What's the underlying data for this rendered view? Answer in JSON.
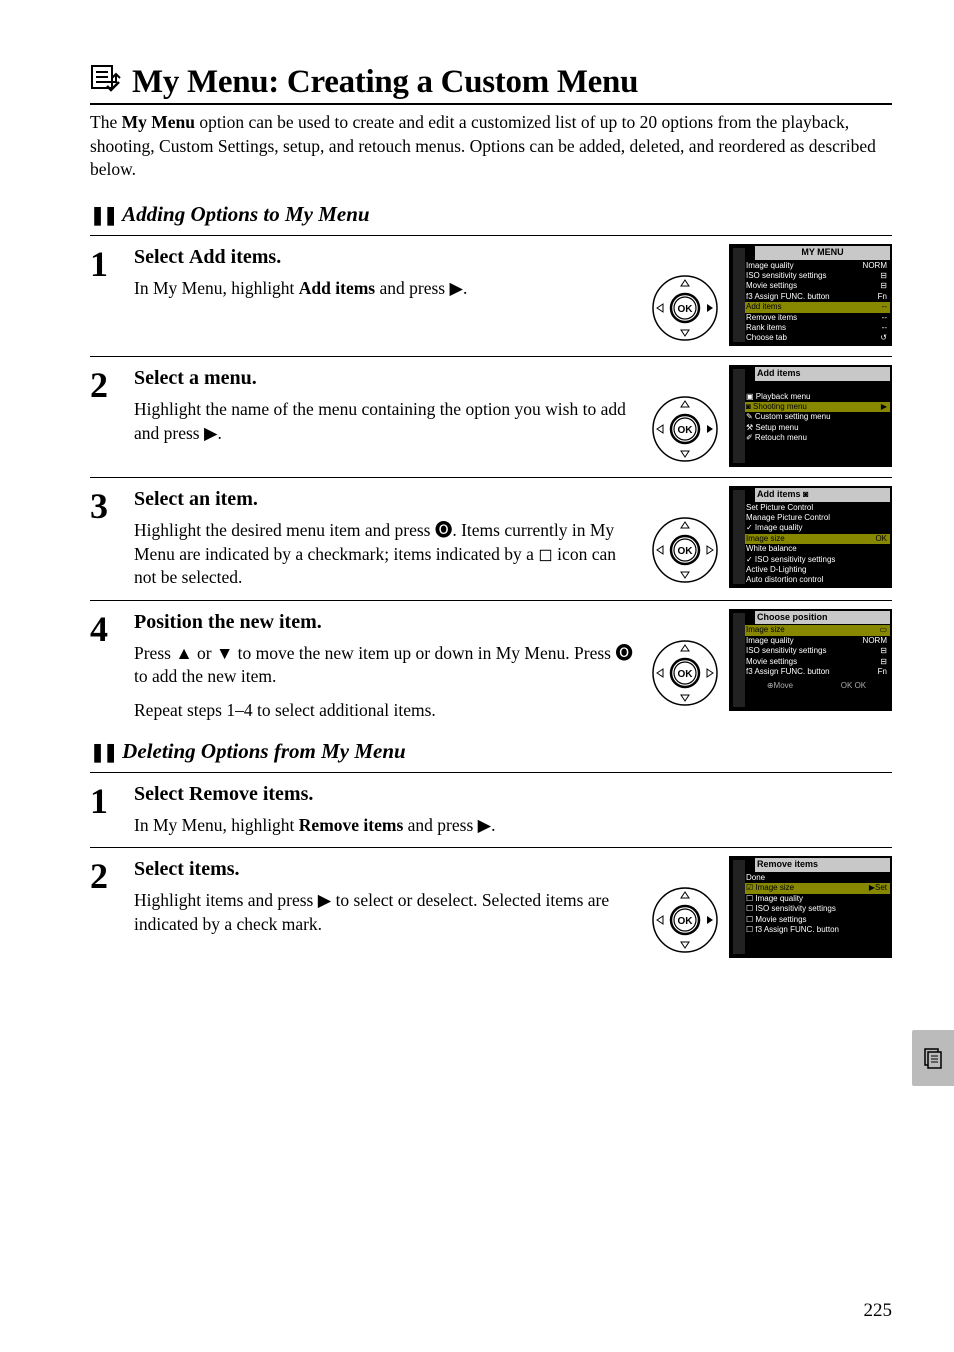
{
  "pageNumber": "225",
  "title": "My Menu: Creating a Custom Menu",
  "intro_before": "The ",
  "intro_bold": "My Menu",
  "intro_after": " option can be used to create and edit a customized list of up to 20 options from the playback, shooting, Custom Settings, setup, and retouch menus. Options can be added, deleted, and reordered as described below.",
  "sections": {
    "add": {
      "heading": "Adding Options to My Menu",
      "steps": [
        {
          "num": "1",
          "title_pre": "Select ",
          "title_bold": "Add items",
          "title_post": ".",
          "body_pre": "In My Menu, highlight ",
          "body_bold": "Add items",
          "body_post": " and press ▶."
        },
        {
          "num": "2",
          "title_pre": "Select a menu.",
          "title_bold": "",
          "title_post": "",
          "body_pre": "Highlight the name of the menu containing the option you wish to add and press ▶.",
          "body_bold": "",
          "body_post": ""
        },
        {
          "num": "3",
          "title_pre": "Select an item.",
          "title_bold": "",
          "title_post": "",
          "body_pre": "Highlight the desired menu item and press 🅞. Items currently in My Menu are indicated by a checkmark; items indicated by a ◻ icon can not be selected.",
          "body_bold": "",
          "body_post": ""
        },
        {
          "num": "4",
          "title_pre": "Position the new item.",
          "title_bold": "",
          "title_post": "",
          "body_pre": "Press ▲ or ▼ to move the new item up or down in My Menu.  Press 🅞 to add the new item.",
          "body_bold": "",
          "body_post": "",
          "body2": "Repeat steps 1–4 to select additional items."
        }
      ]
    },
    "del": {
      "heading": "Deleting Options from My Menu",
      "steps": [
        {
          "num": "1",
          "title_pre": "Select ",
          "title_bold": "Remove items",
          "title_post": ".",
          "body_pre": "In My Menu, highlight ",
          "body_bold": "Remove items",
          "body_post": " and press ▶."
        },
        {
          "num": "2",
          "title_pre": "Select items.",
          "title_bold": "",
          "title_post": "",
          "body_pre": "Highlight items and press ▶ to select or deselect.  Selected items are indicated by a check mark.",
          "body_bold": "",
          "body_post": ""
        }
      ]
    }
  },
  "lcd": {
    "s1": {
      "header": "MY MENU",
      "rows": [
        {
          "l": "Image quality",
          "r": "NORM"
        },
        {
          "l": "ISO sensitivity settings",
          "r": "⊟"
        },
        {
          "l": "Movie settings",
          "r": "⊟"
        },
        {
          "l": "f3 Assign FUNC. button",
          "r": "Fn"
        },
        {
          "l": "Add items",
          "r": "--",
          "sel": true
        },
        {
          "l": "Remove items",
          "r": "--"
        },
        {
          "l": "Rank items",
          "r": "--"
        },
        {
          "l": "Choose tab",
          "r": "↺"
        }
      ]
    },
    "s2": {
      "header": "Add items",
      "rows": [
        {
          "l": "▣  Playback menu",
          "r": ""
        },
        {
          "l": "◙  Shooting menu",
          "r": "▶",
          "sel": true
        },
        {
          "l": "✎  Custom setting menu",
          "r": ""
        },
        {
          "l": "⚒  Setup menu",
          "r": ""
        },
        {
          "l": "✐  Retouch menu",
          "r": ""
        }
      ]
    },
    "s3": {
      "header": "Add items  ◙",
      "rows": [
        {
          "l": "   Set Picture Control",
          "r": ""
        },
        {
          "l": "   Manage Picture Control",
          "r": ""
        },
        {
          "l": "✓  Image quality",
          "r": ""
        },
        {
          "l": "   Image size",
          "r": "OK",
          "sel": true
        },
        {
          "l": "   White balance",
          "r": ""
        },
        {
          "l": "✓  ISO sensitivity settings",
          "r": ""
        },
        {
          "l": "   Active D-Lighting",
          "r": ""
        },
        {
          "l": "   Auto distortion control",
          "r": ""
        }
      ]
    },
    "s4": {
      "header": "Choose position",
      "rows": [
        {
          "l": "Image size",
          "r": "▭",
          "sel": true
        },
        {
          "l": "Image quality",
          "r": "NORM"
        },
        {
          "l": "ISO sensitivity settings",
          "r": "⊟"
        },
        {
          "l": "Movie settings",
          "r": "⊟"
        },
        {
          "l": "f3 Assign FUNC. button",
          "r": "Fn"
        }
      ],
      "foot_l": "⊕Move",
      "foot_r": "OK OK"
    },
    "s5": {
      "header": "Remove items",
      "rows": [
        {
          "l": "    Done",
          "r": ""
        },
        {
          "l": "☑  Image size",
          "r": "▶Set",
          "sel": true
        },
        {
          "l": "☐  Image quality",
          "r": ""
        },
        {
          "l": "☐  ISO sensitivity settings",
          "r": ""
        },
        {
          "l": "☐  Movie settings",
          "r": ""
        },
        {
          "l": "☐  f3 Assign FUNC. button",
          "r": ""
        }
      ]
    }
  }
}
